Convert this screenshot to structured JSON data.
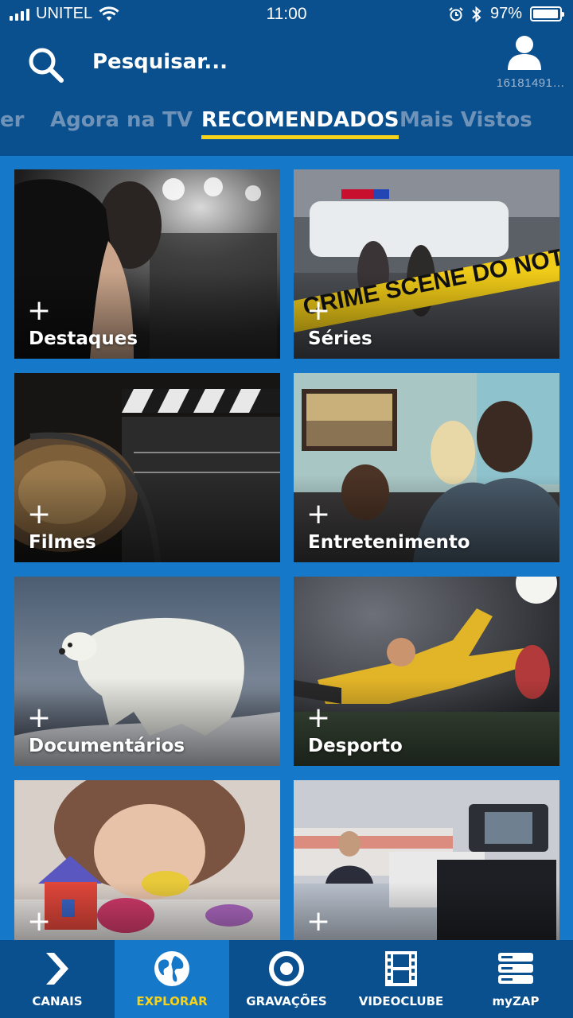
{
  "status_bar": {
    "carrier": "UNITEL",
    "time": "11:00",
    "battery": "97%",
    "battery_level": 0.97
  },
  "header": {
    "search_placeholder": "Pesquisar...",
    "account_id": "16181491…"
  },
  "tabs": [
    {
      "label": "er",
      "active": false
    },
    {
      "label": "Agora na TV",
      "active": false
    },
    {
      "label": "RECOMENDADOS",
      "active": true
    },
    {
      "label": "Mais Vistos",
      "active": false
    }
  ],
  "categories": [
    {
      "label": "Destaques",
      "plus": "+",
      "image": "red-carpet-photo"
    },
    {
      "label": "Séries",
      "plus": "+",
      "image": "crime-scene-photo"
    },
    {
      "label": "Filmes",
      "plus": "+",
      "image": "film-clapper-photo"
    },
    {
      "label": "Entretenimento",
      "plus": "+",
      "image": "family-watching-tv-photo"
    },
    {
      "label": "Documentários",
      "plus": "+",
      "image": "polar-bear-photo"
    },
    {
      "label": "Desporto",
      "plus": "+",
      "image": "goalkeeper-photo"
    },
    {
      "label": "",
      "plus": "+",
      "image": "child-playdough-photo"
    },
    {
      "label": "",
      "plus": "+",
      "image": "tv-studio-camera-photo"
    }
  ],
  "crime_tape_text": "CRIME SCENE DO NOT C",
  "bottom_nav": [
    {
      "label": "CANAIS",
      "icon": "chevron-right-icon",
      "active": false
    },
    {
      "label": "EXPLORAR",
      "icon": "globe-icon",
      "active": true
    },
    {
      "label": "GRAVAÇÕES",
      "icon": "record-icon",
      "active": false
    },
    {
      "label": "VIDEOCLUBE",
      "icon": "film-strip-icon",
      "active": false
    },
    {
      "label": "myZAP",
      "icon": "server-stack-icon",
      "active": false
    }
  ],
  "colors": {
    "header_bg": "#0a4f8e",
    "grid_bg": "#1678c8",
    "accent_yellow": "#f6d21b",
    "inactive_tab": "#6f93b8"
  }
}
